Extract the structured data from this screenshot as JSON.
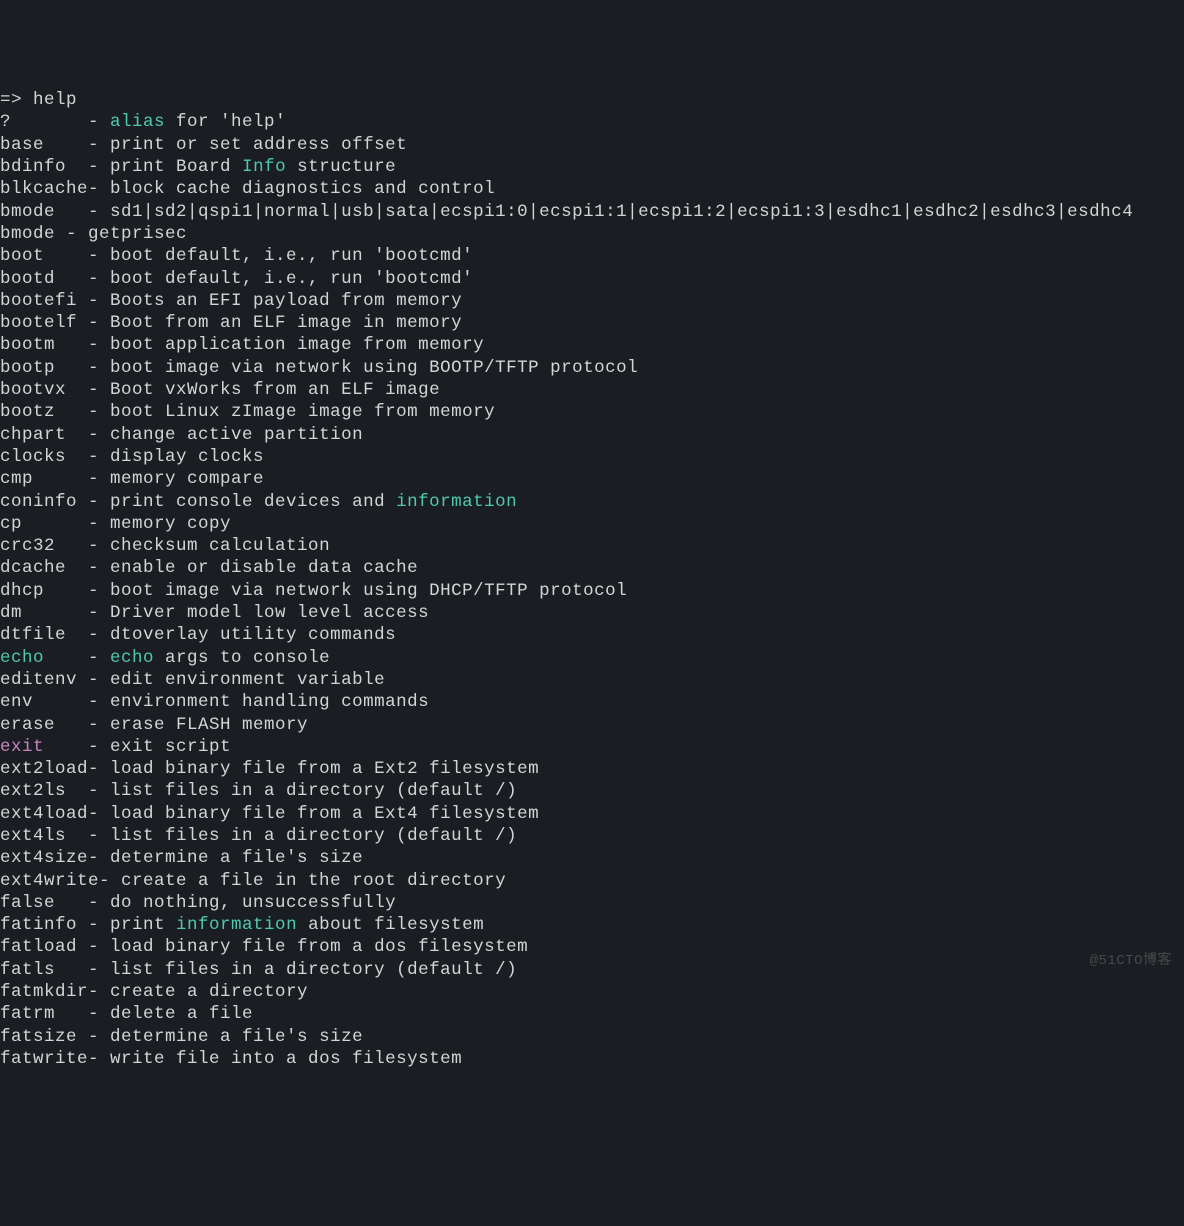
{
  "prompt": "=> help",
  "lines": [
    {
      "cmd": "?",
      "sep": "       - ",
      "parts": [
        {
          "t": "alias",
          "c": "cyan"
        },
        {
          "t": " for 'help'"
        }
      ]
    },
    {
      "cmd": "base",
      "sep": "    - ",
      "parts": [
        {
          "t": "print or set address offset"
        }
      ]
    },
    {
      "cmd": "bdinfo",
      "sep": "  - ",
      "parts": [
        {
          "t": "print Board "
        },
        {
          "t": "Info",
          "c": "cyan"
        },
        {
          "t": " structure"
        }
      ]
    },
    {
      "cmd": "blkcache",
      "sep": "- ",
      "parts": [
        {
          "t": "block cache diagnostics and control"
        }
      ]
    },
    {
      "cmd": "bmode",
      "sep": "   - ",
      "parts": [
        {
          "t": "sd1|sd2|qspi1|normal|usb|sata|ecspi1:0|ecspi1:1|ecspi1:2|ecspi1:3|esdhc1|esdhc2|esdhc3|esdhc4"
        }
      ]
    },
    {
      "cmd": "bmode - getprisec",
      "sep": "",
      "parts": []
    },
    {
      "cmd": "boot",
      "sep": "    - ",
      "parts": [
        {
          "t": "boot default, i.e., run 'bootcmd'"
        }
      ]
    },
    {
      "cmd": "bootd",
      "sep": "   - ",
      "parts": [
        {
          "t": "boot default, i.e., run 'bootcmd'"
        }
      ]
    },
    {
      "cmd": "bootefi",
      "sep": " - ",
      "parts": [
        {
          "t": "Boots an EFI payload from memory"
        }
      ]
    },
    {
      "cmd": "bootelf",
      "sep": " - ",
      "parts": [
        {
          "t": "Boot from an ELF image in memory"
        }
      ]
    },
    {
      "cmd": "bootm",
      "sep": "   - ",
      "parts": [
        {
          "t": "boot application image from memory"
        }
      ]
    },
    {
      "cmd": "bootp",
      "sep": "   - ",
      "parts": [
        {
          "t": "boot image via network using BOOTP/TFTP protocol"
        }
      ]
    },
    {
      "cmd": "bootvx",
      "sep": "  - ",
      "parts": [
        {
          "t": "Boot vxWorks from an ELF image"
        }
      ]
    },
    {
      "cmd": "bootz",
      "sep": "   - ",
      "parts": [
        {
          "t": "boot Linux zImage image from memory"
        }
      ]
    },
    {
      "cmd": "chpart",
      "sep": "  - ",
      "parts": [
        {
          "t": "change active partition"
        }
      ]
    },
    {
      "cmd": "clocks",
      "sep": "  - ",
      "parts": [
        {
          "t": "display clocks"
        }
      ]
    },
    {
      "cmd": "cmp",
      "sep": "     - ",
      "parts": [
        {
          "t": "memory compare"
        }
      ]
    },
    {
      "cmd": "coninfo",
      "sep": " - ",
      "parts": [
        {
          "t": "print console devices and "
        },
        {
          "t": "information",
          "c": "cyan"
        }
      ]
    },
    {
      "cmd": "cp",
      "sep": "      - ",
      "parts": [
        {
          "t": "memory copy"
        }
      ]
    },
    {
      "cmd": "crc32",
      "sep": "   - ",
      "parts": [
        {
          "t": "checksum calculation"
        }
      ]
    },
    {
      "cmd": "dcache",
      "sep": "  - ",
      "parts": [
        {
          "t": "enable or disable data cache"
        }
      ]
    },
    {
      "cmd": "dhcp",
      "sep": "    - ",
      "parts": [
        {
          "t": "boot image via network using DHCP/TFTP protocol"
        }
      ]
    },
    {
      "cmd": "dm",
      "sep": "      - ",
      "parts": [
        {
          "t": "Driver model low level access"
        }
      ]
    },
    {
      "cmd": "dtfile",
      "sep": "  - ",
      "parts": [
        {
          "t": "dtoverlay utility commands"
        }
      ]
    },
    {
      "cmd": "echo",
      "cmdc": "cyan",
      "sep": "    - ",
      "parts": [
        {
          "t": "echo",
          "c": "cyan"
        },
        {
          "t": " args to console"
        }
      ]
    },
    {
      "cmd": "editenv",
      "sep": " - ",
      "parts": [
        {
          "t": "edit environment variable"
        }
      ]
    },
    {
      "cmd": "env",
      "sep": "     - ",
      "parts": [
        {
          "t": "environment handling commands"
        }
      ]
    },
    {
      "cmd": "erase",
      "sep": "   - ",
      "parts": [
        {
          "t": "erase FLASH memory"
        }
      ]
    },
    {
      "cmd": "exit",
      "cmdc": "magenta",
      "sep": "    - ",
      "parts": [
        {
          "t": "exit script"
        }
      ]
    },
    {
      "cmd": "ext2load",
      "sep": "- ",
      "parts": [
        {
          "t": "load binary file from a Ext2 filesystem"
        }
      ]
    },
    {
      "cmd": "ext2ls",
      "sep": "  - ",
      "parts": [
        {
          "t": "list files in a directory (default /)"
        }
      ]
    },
    {
      "cmd": "ext4load",
      "sep": "- ",
      "parts": [
        {
          "t": "load binary file from a Ext4 filesystem"
        }
      ]
    },
    {
      "cmd": "ext4ls",
      "sep": "  - ",
      "parts": [
        {
          "t": "list files in a directory (default /)"
        }
      ]
    },
    {
      "cmd": "ext4size",
      "sep": "- ",
      "parts": [
        {
          "t": "determine a file's size"
        }
      ]
    },
    {
      "cmd": "ext4write",
      "sep": "- ",
      "parts": [
        {
          "t": "create a file in the root directory"
        }
      ]
    },
    {
      "cmd": "false",
      "sep": "   - ",
      "parts": [
        {
          "t": "do nothing, unsuccessfully"
        }
      ]
    },
    {
      "cmd": "fatinfo",
      "sep": " - ",
      "parts": [
        {
          "t": "print "
        },
        {
          "t": "information",
          "c": "cyan"
        },
        {
          "t": " about filesystem"
        }
      ]
    },
    {
      "cmd": "fatload",
      "sep": " - ",
      "parts": [
        {
          "t": "load binary file from a dos filesystem"
        }
      ]
    },
    {
      "cmd": "fatls",
      "sep": "   - ",
      "parts": [
        {
          "t": "list files in a directory (default /)"
        }
      ]
    },
    {
      "cmd": "fatmkdir",
      "sep": "- ",
      "parts": [
        {
          "t": "create a directory"
        }
      ]
    },
    {
      "cmd": "fatrm",
      "sep": "   - ",
      "parts": [
        {
          "t": "delete a file"
        }
      ]
    },
    {
      "cmd": "fatsize",
      "sep": " - ",
      "parts": [
        {
          "t": "determine a file's size"
        }
      ]
    },
    {
      "cmd": "fatwrite",
      "sep": "- ",
      "parts": [
        {
          "t": "write file into a dos filesystem"
        }
      ]
    }
  ],
  "watermark": "@51CTO博客"
}
